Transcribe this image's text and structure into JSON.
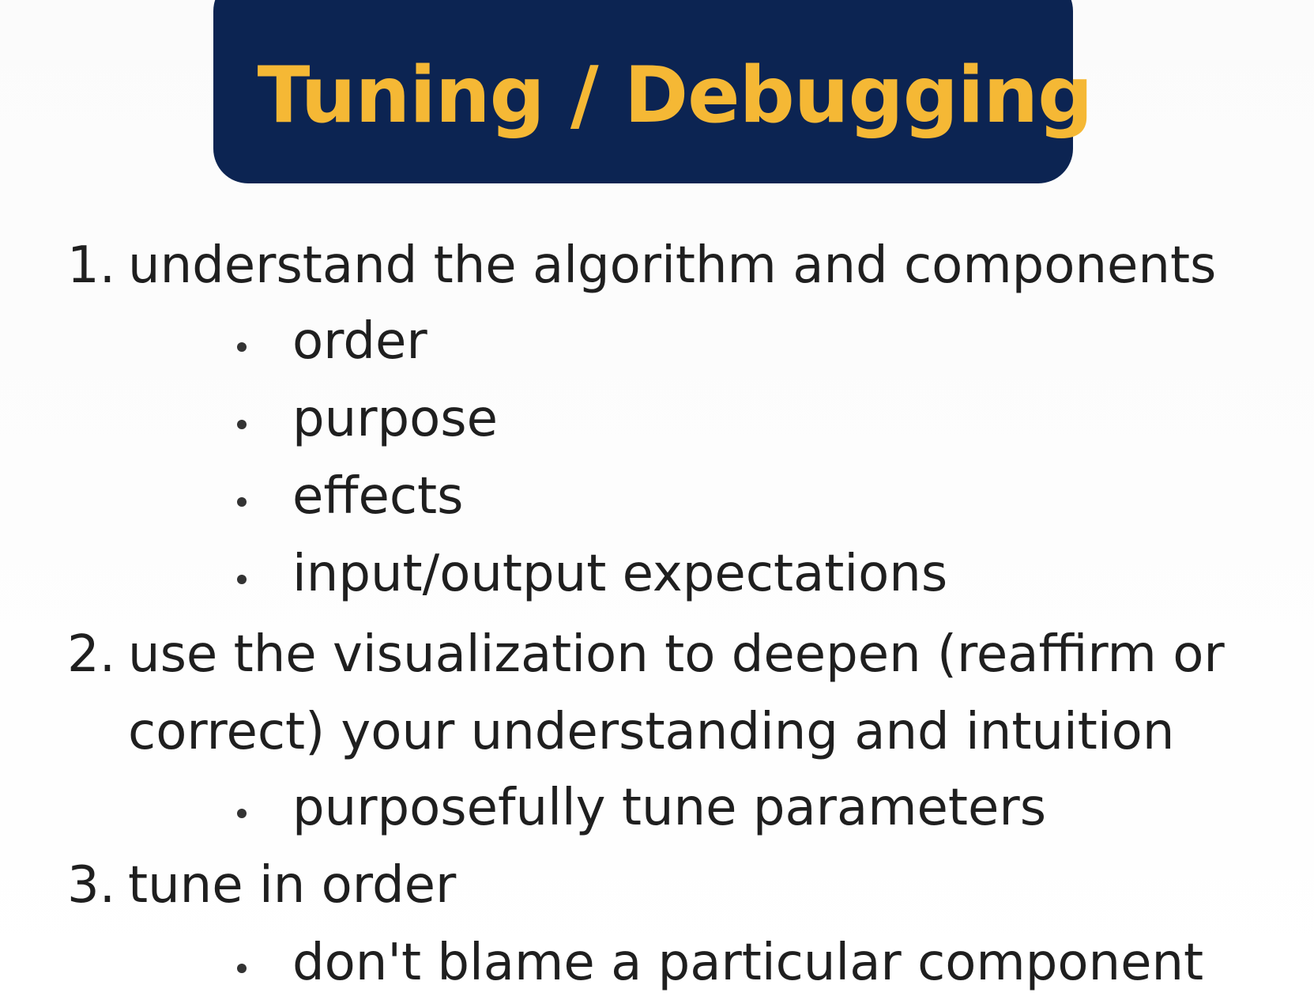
{
  "title": "Tuning / Debugging",
  "list": {
    "item1": {
      "number": "1.",
      "text": "understand the algorithm and components",
      "bullets": [
        "order",
        "purpose",
        "effects",
        "input/output expectations"
      ]
    },
    "item2": {
      "number": "2.",
      "text_line1": "use the visualization to deepen (reaffirm or",
      "text_line2": "correct) your understanding and intuition",
      "bullets": [
        "purposefully tune parameters"
      ]
    },
    "item3": {
      "number": "3.",
      "text": "tune in order",
      "bullets": [
        "don't blame a particular component"
      ]
    }
  }
}
